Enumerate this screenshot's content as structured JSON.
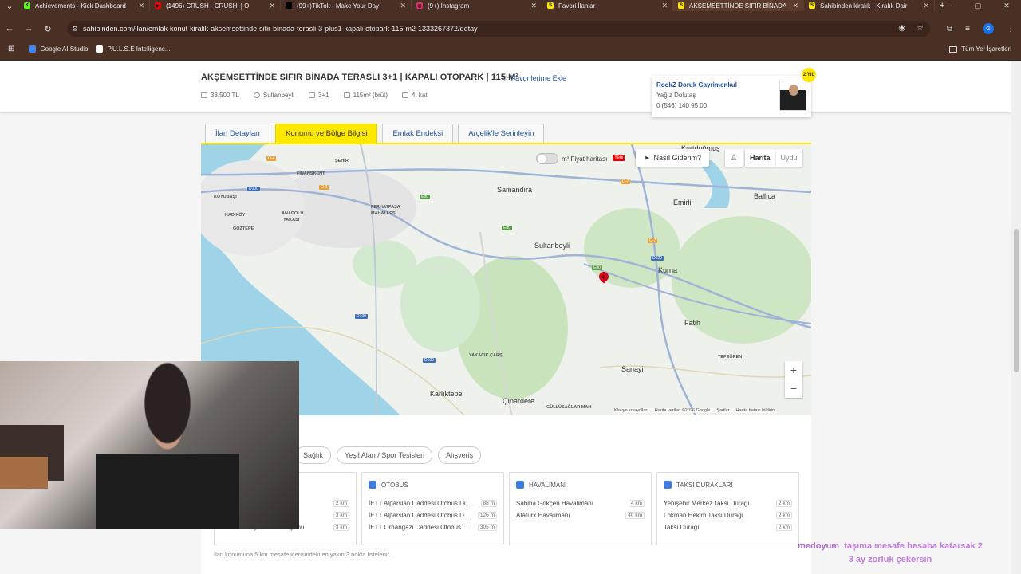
{
  "browser": {
    "tabs": [
      {
        "label": "Achievements - Kick Dashboard",
        "color": "#53fc18",
        "glyph": "K"
      },
      {
        "label": "(1496) CRUSH - CRUSH! | O",
        "color": "#ff0000",
        "glyph": "▶"
      },
      {
        "label": "(99+)TikTok - Make Your Day",
        "color": "#000000",
        "glyph": "♪"
      },
      {
        "label": "(9+) Instagram",
        "color": "#e1306c",
        "glyph": "◎"
      },
      {
        "label": "Favori İlanlar",
        "color": "#ffe800",
        "glyph": "S"
      },
      {
        "label": "AKŞEMSETTİNDE SIFIR BİNADA",
        "color": "#ffe800",
        "glyph": "S",
        "active": true
      },
      {
        "label": "Sahibinden kiralık - Kiralık Dair",
        "color": "#ffe800",
        "glyph": "S"
      }
    ],
    "new_tab": "+",
    "url": "sahibinden.com/ilan/emlak-konut-kiralik-aksemsettinde-sifir-binada-terasli-3-plus1-kapali-otopark-115-m2-1333267372/detay",
    "bookmarks": [
      {
        "label": "Google AI Studio"
      },
      {
        "label": "P.U.L.S.E Intelligenc..."
      }
    ],
    "all_bookmarks": "Tüm Yer İşaretleri",
    "profile_initial": "G"
  },
  "listing": {
    "title": "AKŞEMSETTİNDE SIFIR BİNADA TERASLI 3+1 | KAPALI OTOPARK | 115 M²",
    "add_favorite": "Favorilerime Ekle",
    "price": "33.500 TL",
    "district": "Sultanbeyli",
    "rooms": "3+1",
    "area": "115m² (brüt)",
    "floor": "4. kat"
  },
  "seller": {
    "name": "RookZ Doruk Gayrimenkul",
    "agent": "Yağız Dolutaş",
    "phone": "0 (546) 140 95 00",
    "badge": "2 YIL"
  },
  "tabs": [
    {
      "label": "İlan Detayları"
    },
    {
      "label": "Konumu ve Bölge Bilgisi",
      "active": true
    },
    {
      "label": "Emlak Endeksi"
    },
    {
      "label": "Arçelik'le Serinleyin"
    }
  ],
  "map": {
    "toggle_label": "m² Fiyat haritası",
    "new_badge": "Yeni",
    "directions": "Nasıl Giderim?",
    "type_map": "Harita",
    "type_sat": "Uydu",
    "zoom_in": "+",
    "zoom_out": "−",
    "google": "Google",
    "attribution": [
      "Klavye kısayolları",
      "Harita verileri ©2026 Google",
      "Şartlar",
      "Harita hatası bildirin"
    ],
    "places": {
      "kurtdogmus": "Kurtdoğmuş",
      "samandira": "Samandıra",
      "ballica": "Ballıca",
      "emirli": "Emirli",
      "sultanbeyli": "Sultanbeyli",
      "kurna": "Kurna",
      "fatih": "Fatih",
      "sanayi": "Sanayi",
      "karliktepe": "Karlıktepe",
      "cinardere": "Çınardere",
      "finanskent": "FİNANSKENT",
      "kuyubasi": "KUYUBAŞI",
      "kadikoy": "KADIKÖY",
      "goztepe": "GÖZTEPE",
      "anadolu": "ANADOLU",
      "yakasi": "YAKASI",
      "ferhatpasa": "FERHATPAŞA",
      "mahallesi": "MAHALLESİ",
      "yakacik": "YAKACIK ÇARŞI",
      "tepeoren": "TEPEÖREN",
      "gullusaglar": "GÜLLÜSAĞLAR MAH",
      "sehir": "ŞEHİR"
    },
    "shields": {
      "o4": "O-4",
      "d100a": "D100",
      "o2": "O-2",
      "o7a": "O-7",
      "o7b": "O-7",
      "e80a": "E80",
      "e80b": "E80",
      "e80c": "E80",
      "d020": "D020",
      "d100b": "D100",
      "d100c": "D100"
    }
  },
  "poi": {
    "chips": [
      {
        "label": "Sağlık"
      },
      {
        "label": "Yeşil Alan / Spor Tesisleri"
      },
      {
        "label": "Alışveriş"
      }
    ],
    "boxes": [
      {
        "title": "",
        "rows": [
          {
            "name": "...nu",
            "dist": "2 km"
          },
          {
            "name": "",
            "dist": "3 km"
          },
          {
            "name": "M4 - Kurtköy Metro İstasyonu",
            "dist": "3 km"
          }
        ]
      },
      {
        "title": "OTOBÜS",
        "rows": [
          {
            "name": "İETT Alparslan Caddesi Otobüs Du...",
            "dist": "88 m"
          },
          {
            "name": "İETT Alparslan Caddesi Otobüs D...",
            "dist": "126 m"
          },
          {
            "name": "İETT Orhangazi Caddesi Otobüs ...",
            "dist": "305 m"
          }
        ]
      },
      {
        "title": "HAVALİMANI",
        "rows": [
          {
            "name": "Sabiha Gökçen Havalimanı",
            "dist": "4 km"
          },
          {
            "name": "Atatürk Havalimanı",
            "dist": "40 km"
          }
        ]
      },
      {
        "title": "TAKSİ DURAKLARI",
        "rows": [
          {
            "name": "Yenişehir Merkez Taksi Durağı",
            "dist": "2 km"
          },
          {
            "name": "Lokman Hekim Taksi Durağı",
            "dist": "2 km"
          },
          {
            "name": "Taksi Durağı",
            "dist": "2 km"
          }
        ]
      }
    ],
    "note": "İlan konumuna 5 km mesafe içerisindeki en yakın 3 nokta listelenir."
  },
  "overlay": {
    "user": "medoyum",
    "message_a": "taşıma mesafe hesaba katarsak 2",
    "message_b": "3 ay zorluk çekersin"
  }
}
